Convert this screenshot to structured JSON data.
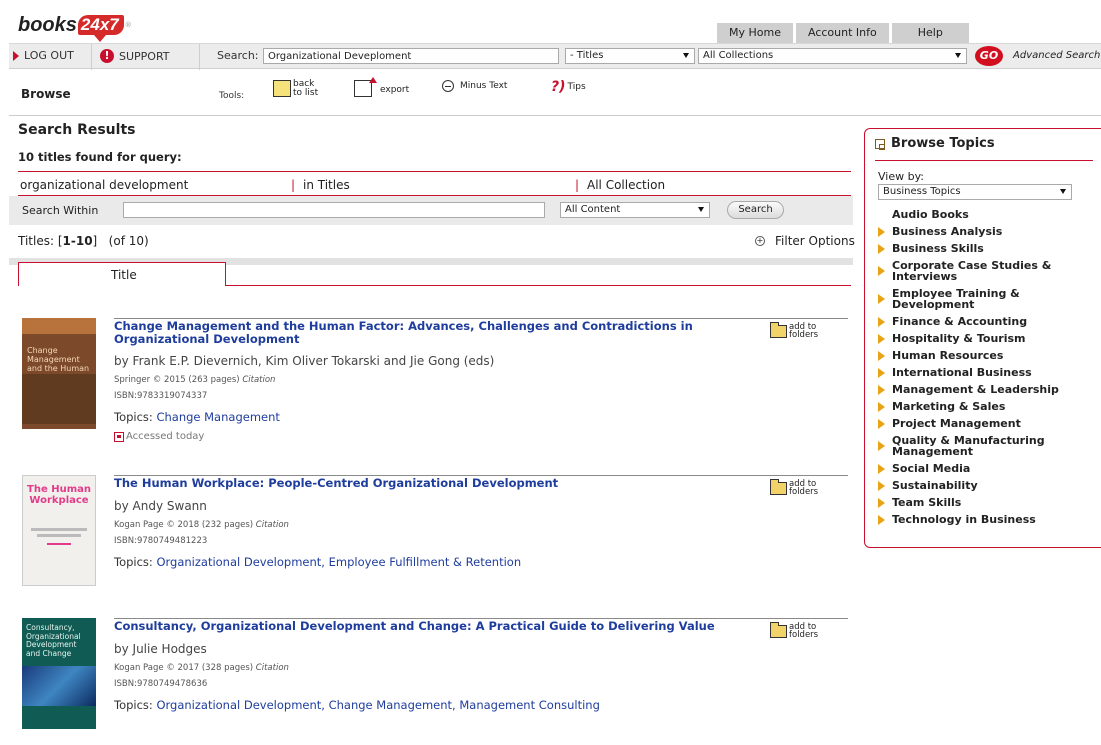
{
  "logo": {
    "part1": "books",
    "part2": "24x7",
    "tm": "®"
  },
  "top_tabs": [
    "My Home",
    "Account Info",
    "Help"
  ],
  "header": {
    "logout": "LOG OUT",
    "support": "SUPPORT",
    "search_label": "Search:",
    "search_value": "Organizational Deveploment",
    "scope": "- Titles",
    "collection": "All Collections",
    "go": "GO",
    "advanced": "Advanced Search"
  },
  "toolbar": {
    "browse": "Browse",
    "tools": "Tools:",
    "back_to_list": "back to list",
    "export": "export",
    "minus_text": "Minus Text",
    "tips": "Tips"
  },
  "results": {
    "heading": "Search Results",
    "found": "10 titles found for query:",
    "query_term": "organizational development",
    "sep": "|",
    "query_scope": "in Titles",
    "query_collection": "All Collection",
    "search_within_label": "Search Within",
    "content_scope": "All Content",
    "search_button": "Search",
    "titles_prefix": "Titles: [",
    "titles_range": "1-10",
    "titles_suffix": "]   (of 10)",
    "filter_options": "Filter Options",
    "sort_tab": "Title"
  },
  "items": [
    {
      "title": "Change Management and the Human Factor: Advances, Challenges and Contradictions in Organizational Development",
      "authors": "by  Frank E.P. Dievernich, Kim Oliver Tokarski and Jie Gong (eds)",
      "publisher": "Springer © 2015 (263 pages)",
      "citation": "Citation",
      "isbn": "ISBN:9783319074337",
      "topics_label": "Topics:",
      "topics": "Change Management",
      "accessed": "Accessed today",
      "add_folders": "add to folders",
      "cover_text": "Change Management and the Human Factor"
    },
    {
      "title": "The Human Workplace: People-Centred Organizational Development",
      "authors": "by  Andy Swann",
      "publisher": "Kogan Page © 2018 (232 pages)",
      "citation": "Citation",
      "isbn": "ISBN:9780749481223",
      "topics_label": "Topics:",
      "topics": "Organizational Development, Employee Fulfillment & Retention",
      "add_folders": "add to folders",
      "cover_text": "The Human Workplace"
    },
    {
      "title": "Consultancy, Organizational Development and Change: A Practical Guide to Delivering Value",
      "authors": "by  Julie Hodges",
      "publisher": "Kogan Page © 2017 (328 pages)",
      "citation": "Citation",
      "isbn": "ISBN:9780749478636",
      "topics_label": "Topics:",
      "topics": "Organizational Development, Change Management, Management Consulting",
      "add_folders": "add to folders",
      "cover_text": "Consultancy, Organizational Development and Change"
    }
  ],
  "browse_topics": {
    "heading": "Browse Topics",
    "view_by_label": "View by:",
    "view_by_value": "Business Topics",
    "topics": [
      "Audio Books",
      "Business Analysis",
      "Business Skills",
      "Corporate Case Studies & Interviews",
      "Employee Training & Development",
      "Finance & Accounting",
      "Hospitality & Tourism",
      "Human Resources",
      "International Business",
      "Management & Leadership",
      "Marketing & Sales",
      "Project Management",
      "Quality & Manufacturing Management",
      "Social Media",
      "Sustainability",
      "Team Skills",
      "Technology in Business"
    ]
  },
  "colors": {
    "accent": "#c8102e",
    "link": "#1f3d9c",
    "folder": "#f2d36a",
    "topic_arrow": "#e8a317"
  }
}
